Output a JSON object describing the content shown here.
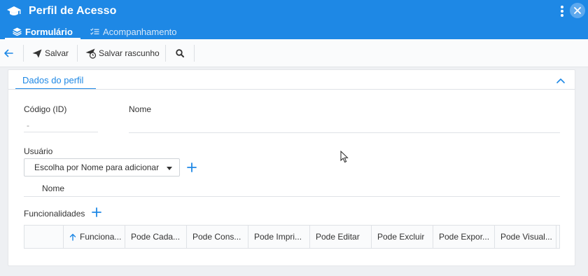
{
  "header": {
    "title": "Perfil de Acesso",
    "tabs": [
      {
        "label": "Formulário",
        "icon": "layers-icon",
        "active": true
      },
      {
        "label": "Acompanhamento",
        "icon": "list-check-icon",
        "active": false
      }
    ]
  },
  "toolbar": {
    "save_label": "Salvar",
    "save_draft_label": "Salvar rascunho"
  },
  "section": {
    "title": "Dados do perfil"
  },
  "form": {
    "codigo_label": "Código (ID)",
    "codigo_value": "-",
    "nome_label": "Nome",
    "nome_value": "",
    "usuario_label": "Usuário",
    "usuario_select": "Escolha por Nome para adicionar",
    "usuario_list_header": "Nome",
    "funcionalidades_label": "Funcionalidades"
  },
  "table": {
    "columns": [
      "Funciona...",
      "Pode Cada...",
      "Pode Cons...",
      "Pode Impri...",
      "Pode Editar",
      "Pode Excluir",
      "Pode Expor...",
      "Pode Visual..."
    ],
    "sorted_column_index": 0
  },
  "colors": {
    "accent": "#1e88e5",
    "header_bg": "#1e88e5",
    "page_bg": "#eef0f3"
  }
}
